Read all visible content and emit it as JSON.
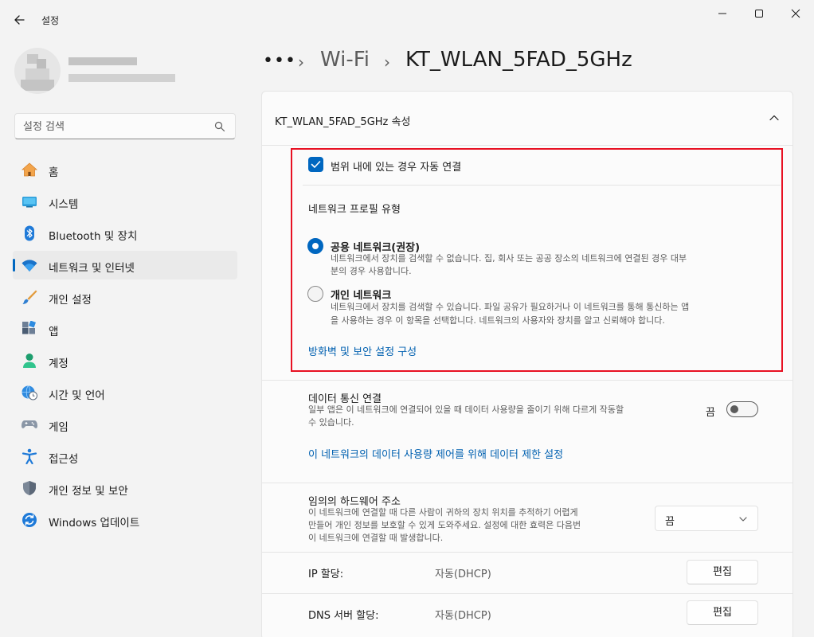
{
  "window": {
    "title": "설정",
    "controls": [
      "minimize-icon",
      "maximize-icon",
      "close-icon"
    ]
  },
  "search": {
    "placeholder": "설정 검색"
  },
  "sidebar": {
    "items": [
      {
        "label": "홈",
        "icon": "home-icon"
      },
      {
        "label": "시스템",
        "icon": "system-icon"
      },
      {
        "label": "Bluetooth 및 장치",
        "icon": "bluetooth-icon"
      },
      {
        "label": "네트워크 및 인터넷",
        "icon": "wifi-icon",
        "active": true
      },
      {
        "label": "개인 설정",
        "icon": "brush-icon"
      },
      {
        "label": "앱",
        "icon": "apps-icon"
      },
      {
        "label": "계정",
        "icon": "account-icon"
      },
      {
        "label": "시간 및 언어",
        "icon": "globe-clock-icon"
      },
      {
        "label": "게임",
        "icon": "gamepad-icon"
      },
      {
        "label": "접근성",
        "icon": "accessibility-icon"
      },
      {
        "label": "개인 정보 및 보안",
        "icon": "shield-icon"
      },
      {
        "label": "Windows 업데이트",
        "icon": "update-icon"
      }
    ]
  },
  "breadcrumb": {
    "overflow": "•••",
    "items": [
      "Wi-Fi",
      "KT_WLAN_5FAD_5GHz"
    ]
  },
  "properties": {
    "header": "KT_WLAN_5FAD_5GHz 속성",
    "auto_connect": {
      "label": "범위 내에 있는 경우 자동 연결",
      "checked": true
    },
    "profile_heading": "네트워크 프로필 유형",
    "public": {
      "label": "공용 네트워크(권장)",
      "desc_line1": "네트워크에서 장치를 검색할 수 없습니다. 집, 회사 또는 공공 장소의 네트워크에 연결된 경우 대부",
      "desc_line2": "분의 경우 사용합니다.",
      "selected": true
    },
    "private": {
      "label": "개인 네트워크",
      "desc_line1": "네트워크에서 장치를 검색할 수 있습니다. 파일 공유가 필요하거나 이 네트워크를 통해 통신하는 앱",
      "desc_line2": "을 사용하는 경우 이 항목을 선택합니다. 네트워크의 사용자와 장치를 알고 신뢰해야 합니다.",
      "selected": false
    },
    "firewall_link": "방화벽 및 보안 설정 구성",
    "metered": {
      "title": "데이터 통신 연결",
      "desc_line1": "일부 앱은 이 네트워크에 연결되어 있을 때 데이터 사용량을 줄이기 위해 다르게 작동할",
      "desc_line2": "수 있습니다.",
      "toggle_label": "끔",
      "toggle_on": false
    },
    "data_limit_link": "이 네트워크의 데이터 사용량 제어를 위해 데이터 제한 설정",
    "random_hw": {
      "title": "임의의 하드웨어 주소",
      "desc_line1": "이 네트워크에 연결할 때 다른 사람이 귀하의 장치 위치를 추적하기 어렵게",
      "desc_line2": "만들어 개인 정보를 보호할 수 있게 도와주세요. 설정에 대한 효력은 다음번",
      "desc_line3": "이 네트워크에 연결할 때 발생합니다.",
      "selected": "끔"
    },
    "ip": {
      "label": "IP 할당:",
      "value": "자동(DHCP)",
      "button": "편집"
    },
    "dns": {
      "label": "DNS 서버 할당:",
      "value": "자동(DHCP)",
      "button": "편집"
    }
  },
  "colors": {
    "accent": "#0067c0",
    "highlight_border": "#e81123",
    "link": "#0060b0"
  }
}
